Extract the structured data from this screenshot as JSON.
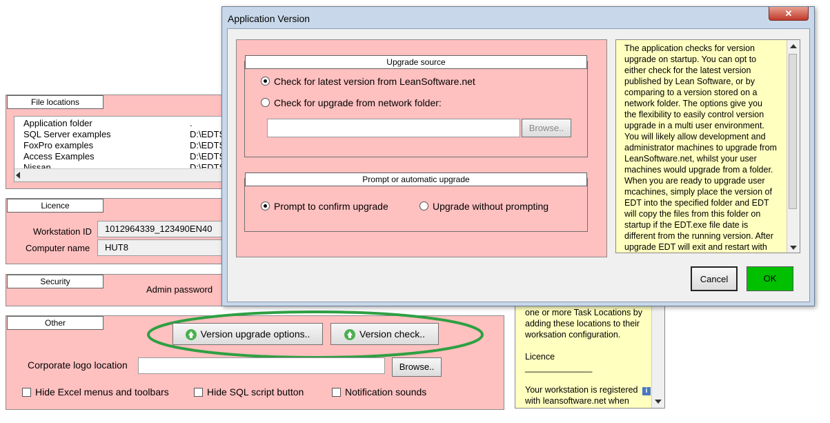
{
  "main": {
    "file_locations": {
      "title": "File locations",
      "rows": [
        {
          "name": "Application folder",
          "path": "."
        },
        {
          "name": "SQL Server examples",
          "path": "D:\\EDTS"
        },
        {
          "name": "FoxPro examples",
          "path": "D:\\EDTS"
        },
        {
          "name": "Access Examples",
          "path": "D:\\EDTS"
        },
        {
          "name": "Nissan",
          "path": "D:\\EDTS"
        }
      ]
    },
    "licence": {
      "title": "Licence",
      "workstation_label": "Workstation ID",
      "workstation_value": "1012964339_123490EN40",
      "computer_label": "Computer name",
      "computer_value": "HUT8"
    },
    "security": {
      "title": "Security",
      "admin_label": "Admin password"
    },
    "other": {
      "title": "Other",
      "version_upgrade_button": "Version upgrade options..",
      "version_check_button": "Version check..",
      "logo_label": "Corporate logo location",
      "logo_value": "",
      "browse_button": "Browse..",
      "hide_excel": "Hide Excel menus and toolbars",
      "hide_sql": "Hide SQL script button",
      "notification": "Notification sounds"
    },
    "help_lines": [
      "one or more Task Locations by",
      "adding these locations to their",
      "worksation configuration.",
      "",
      "Licence",
      "______________",
      "",
      "Your workstation is registered",
      "with leansoftware.net when"
    ],
    "info_badge": "i"
  },
  "dialog": {
    "title": "Application Version",
    "close": "✕",
    "upgrade_source": {
      "title": "Upgrade source",
      "option_latest": "Check for latest version from LeanSoftware.net",
      "option_folder": "Check for upgrade from network folder:",
      "folder_value": "",
      "browse_button": "Browse.."
    },
    "prompt": {
      "title": "Prompt or automatic upgrade",
      "option_confirm": "Prompt to confirm upgrade",
      "option_auto": "Upgrade without prompting"
    },
    "help_lines": [
      "The application checks for version",
      "upgrade on startup.  You can opt to",
      "either check for the latest version",
      "published by Lean Software, or by",
      "comparing to a version stored on a",
      "network folder.   The options give you",
      "the flexibility to easily control version",
      "upgrade in a multi user environment.",
      "You will likely allow development and",
      "administrator machines to upgrade from",
      "LeanSoftware.net, whilst your user",
      "machines would upgrade from a folder.",
      "When you are ready to upgrade user",
      "mcachines, simply place the version of",
      "EDT into the specified folder and EDT",
      "will copy the files from this folder on",
      "startup if the EDT.exe file date is",
      "different from the running version.  After",
      "upgrade EDT will exit and restart with"
    ],
    "cancel_button": "Cancel",
    "ok_button": "OK"
  },
  "colors": {
    "panel_pink": "#ffc0c0",
    "help_yellow": "#ffffc0",
    "ok_green": "#00c000",
    "highlight_ellipse": "#2ea043"
  }
}
